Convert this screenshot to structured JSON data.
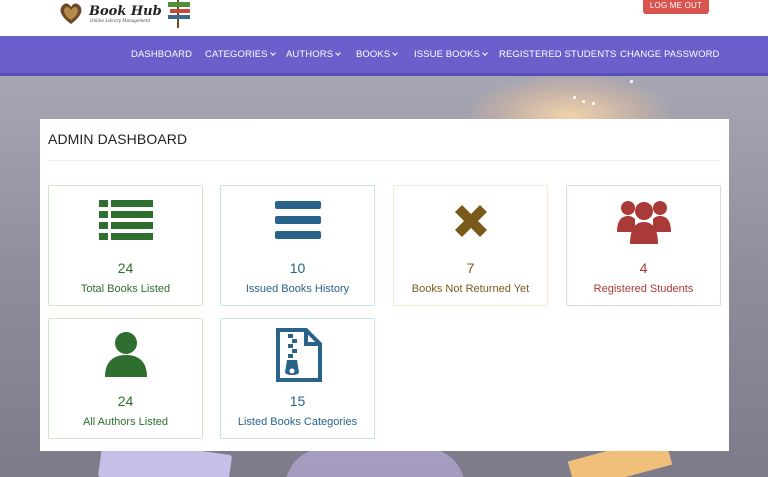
{
  "header": {
    "logo_text": "Book Hub",
    "logo_tagline": "Online Library Management",
    "logout_label": "LOG ME OUT"
  },
  "nav": {
    "items": [
      {
        "label": "DASHBOARD",
        "dropdown": false
      },
      {
        "label": "CATEGORIES",
        "dropdown": true
      },
      {
        "label": "AUTHORS",
        "dropdown": true
      },
      {
        "label": "BOOKS",
        "dropdown": true
      },
      {
        "label": "ISSUE BOOKS",
        "dropdown": true
      },
      {
        "label": "REGISTERED STUDENTS",
        "dropdown": false
      },
      {
        "label": "CHANGE PASSWORD",
        "dropdown": false
      }
    ]
  },
  "dashboard": {
    "title": "ADMIN DASHBOARD",
    "cards": [
      {
        "count": "24",
        "label": "Total Books Listed",
        "icon": "list-icon",
        "color": "#2e6e2e"
      },
      {
        "count": "10",
        "label": "Issued Books History",
        "icon": "bars-icon",
        "color": "#2a6389"
      },
      {
        "count": "7",
        "label": "Books Not Returned Yet",
        "icon": "x-icon",
        "color": "#7a5a1a"
      },
      {
        "count": "4",
        "label": "Registered Students",
        "icon": "users-icon",
        "color": "#a93a38"
      },
      {
        "count": "24",
        "label": "All Authors Listed",
        "icon": "user-icon",
        "color": "#2e6e2e"
      },
      {
        "count": "15",
        "label": "Listed Books Categories",
        "icon": "zip-file-icon",
        "color": "#2a6389"
      }
    ]
  },
  "colors": {
    "nav_bg": "#6b5fcb",
    "logout_bg": "#d9534f",
    "green": "#2e6e2e",
    "blue": "#2a6389",
    "brown": "#7a5a1a",
    "red": "#a93a38"
  }
}
